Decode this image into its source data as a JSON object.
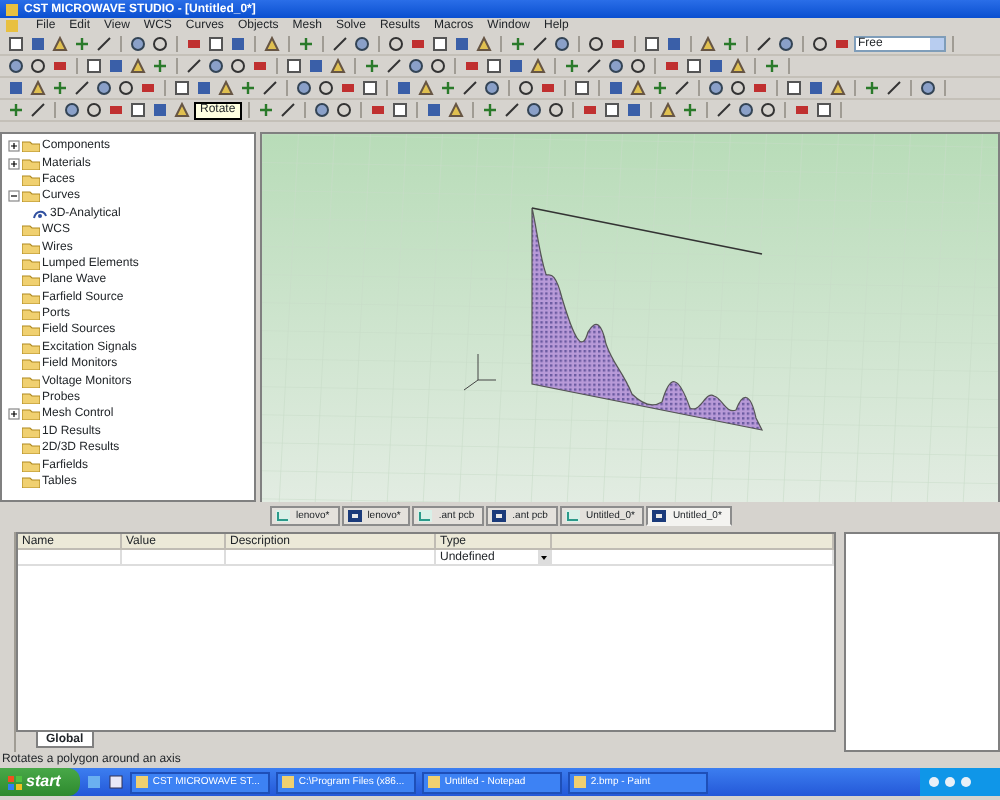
{
  "window": {
    "title": "CST MICROWAVE STUDIO - [Untitled_0*]"
  },
  "menu": [
    "File",
    "Edit",
    "View",
    "WCS",
    "Curves",
    "Objects",
    "Mesh",
    "Solve",
    "Results",
    "Macros",
    "Window",
    "Help"
  ],
  "toolbar": {
    "mode_select": {
      "value": "Free"
    },
    "tooltip": "Rotate"
  },
  "tree": [
    {
      "label": "Components",
      "expanded": false
    },
    {
      "label": "Materials",
      "expanded": false
    },
    {
      "label": "Faces"
    },
    {
      "label": "Curves",
      "expanded": true,
      "children": [
        {
          "label": "3D-Analytical"
        }
      ]
    },
    {
      "label": "WCS"
    },
    {
      "label": "Wires"
    },
    {
      "label": "Lumped Elements"
    },
    {
      "label": "Plane Wave"
    },
    {
      "label": "Farfield Source"
    },
    {
      "label": "Ports"
    },
    {
      "label": "Field Sources"
    },
    {
      "label": "Excitation Signals"
    },
    {
      "label": "Field Monitors"
    },
    {
      "label": "Voltage Monitors"
    },
    {
      "label": "Probes"
    },
    {
      "label": "Mesh Control",
      "expanded": false
    },
    {
      "label": "1D Results"
    },
    {
      "label": "2D/3D Results"
    },
    {
      "label": "Farfields"
    },
    {
      "label": "Tables"
    }
  ],
  "document_tabs": [
    {
      "label": "lenovo*",
      "selected": false
    },
    {
      "label": "lenovo*",
      "selected": false
    },
    {
      "label": ".ant pcb",
      "selected": false
    },
    {
      "label": ".ant pcb",
      "selected": false
    },
    {
      "label": "Untitled_0*",
      "selected": false
    },
    {
      "label": "Untitled_0*",
      "selected": true
    }
  ],
  "parameters": {
    "columns": [
      "Name",
      "Value",
      "Description",
      "Type"
    ],
    "rows": [
      {
        "type": "Undefined"
      }
    ]
  },
  "panel_tab": "Global",
  "status_bar": "Rotates a polygon around an axis",
  "taskbar": {
    "start": "start",
    "tasks": [
      {
        "label": "CST MICROWAVE ST..."
      },
      {
        "label": "C:\\Program Files (x86..."
      },
      {
        "label": "Untitled - Notepad"
      },
      {
        "label": "2.bmp - Paint"
      }
    ]
  }
}
